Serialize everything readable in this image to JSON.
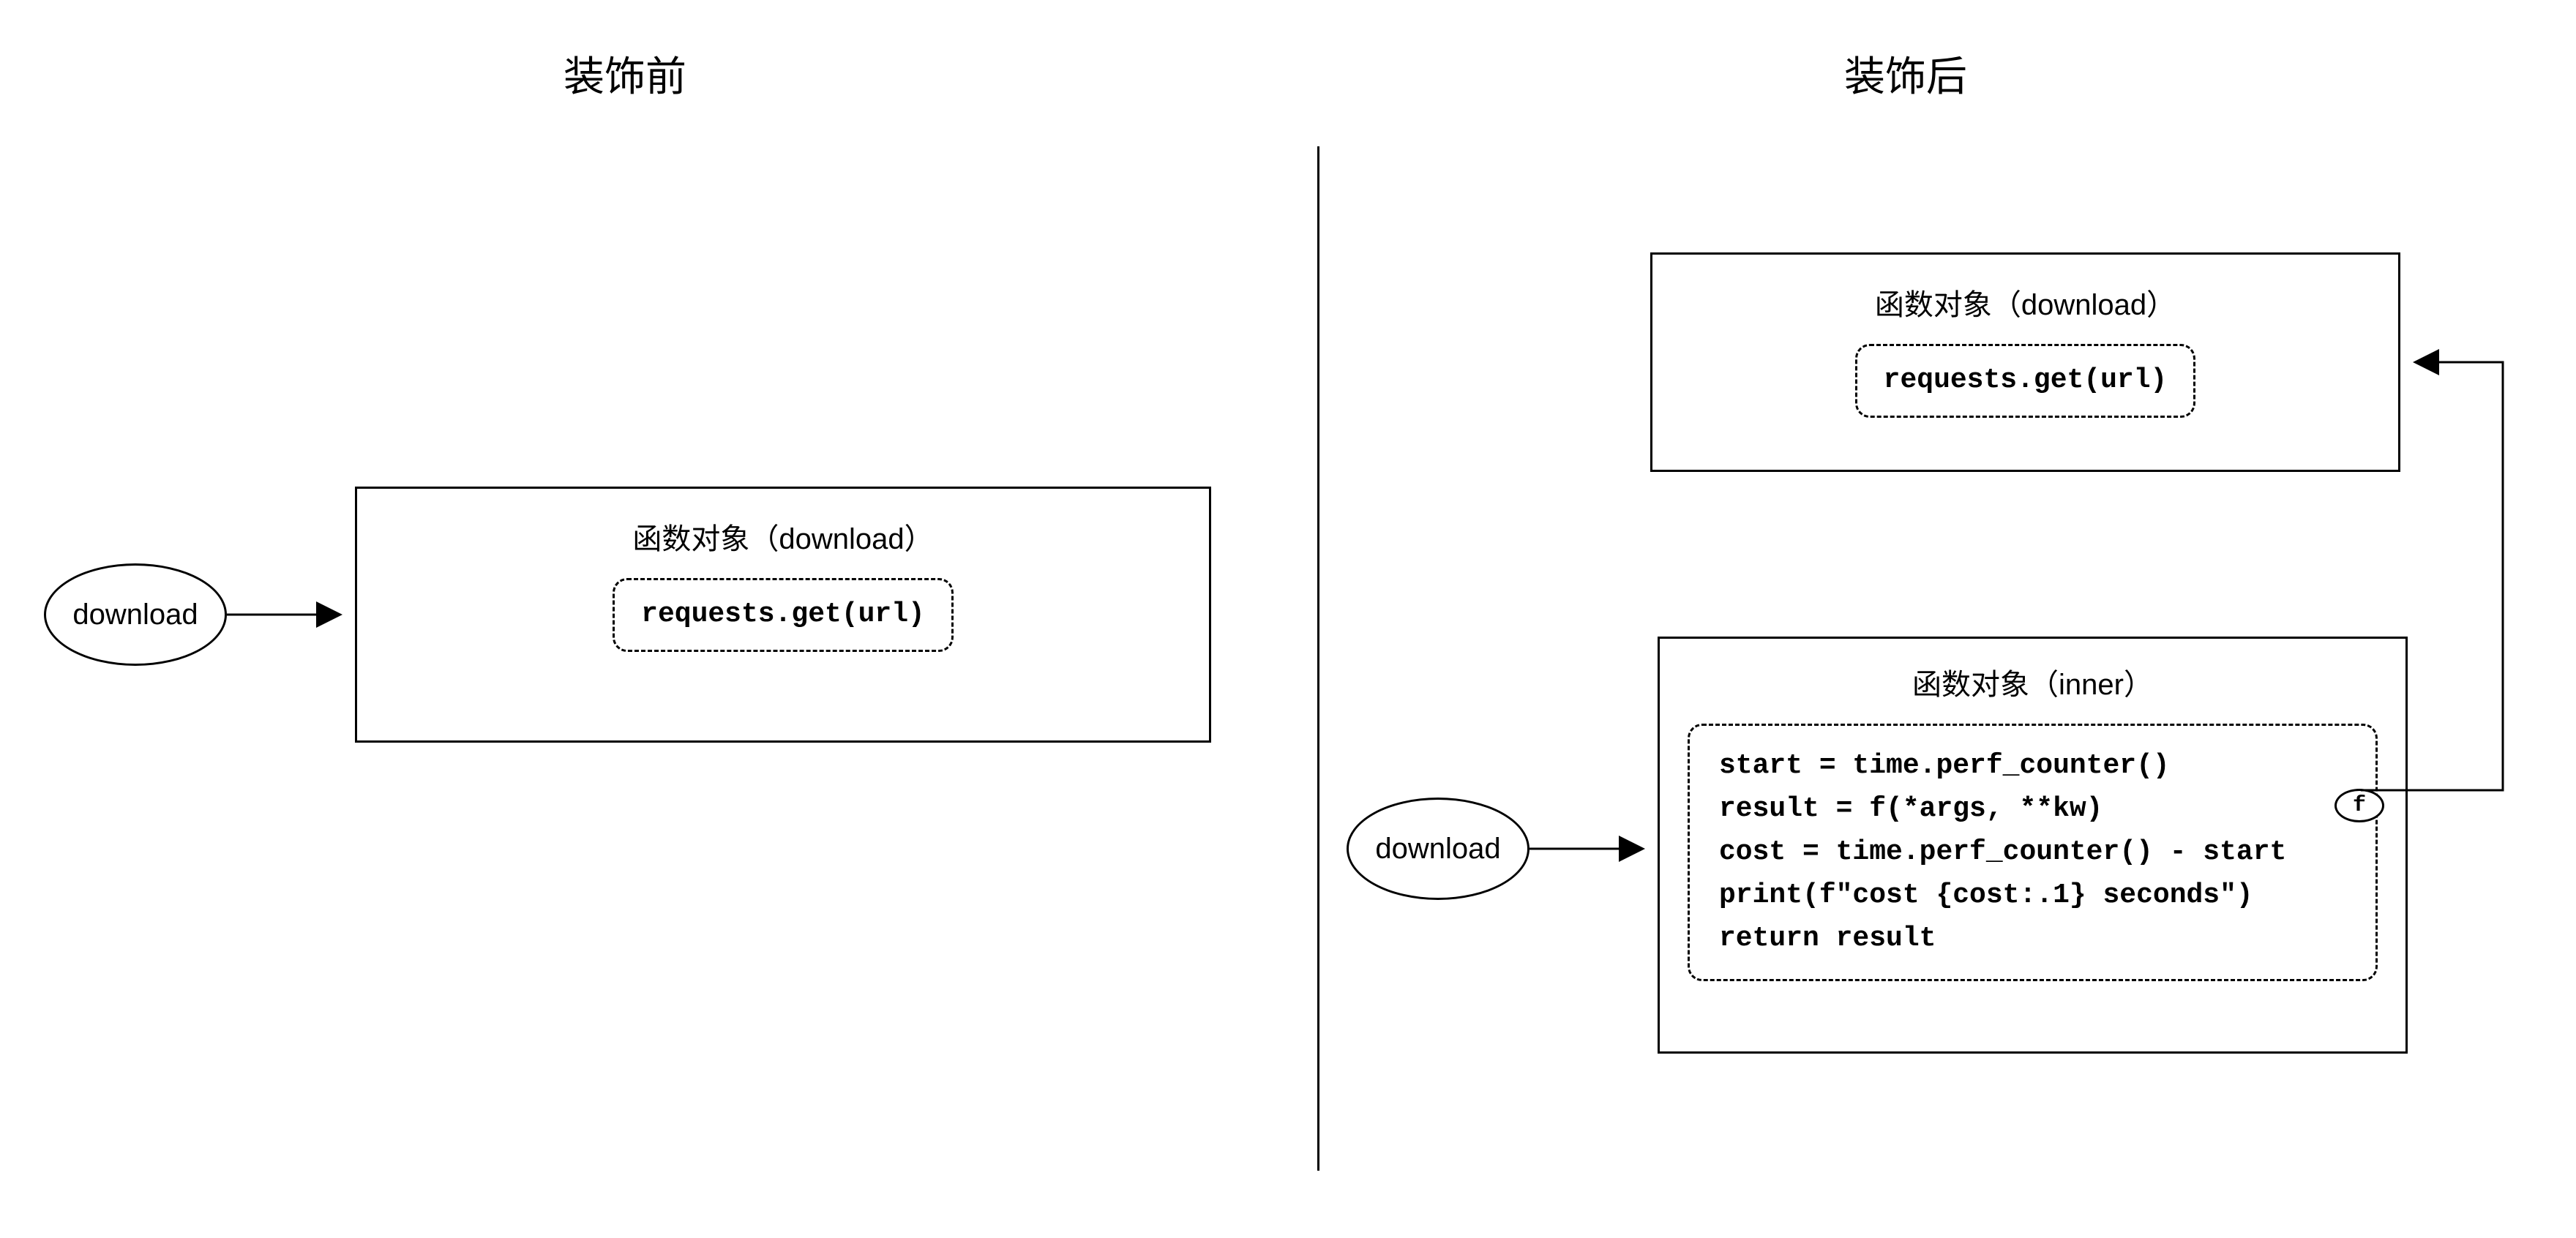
{
  "left": {
    "heading": "装饰前",
    "ellipse_label": "download",
    "box_title": "函数对象（download）",
    "code": "requests.get(url)"
  },
  "right": {
    "heading": "装饰后",
    "ellipse_label": "download",
    "box1_title": "函数对象（download）",
    "box1_code": "requests.get(url)",
    "box2_title": "函数对象（inner）",
    "box2_code": "start = time.perf_counter()\nresult = f(*args, **kw)\ncost = time.perf_counter() - start\nprint(f\"cost {cost:.1} seconds\")\nreturn result",
    "closure_label": "f"
  }
}
